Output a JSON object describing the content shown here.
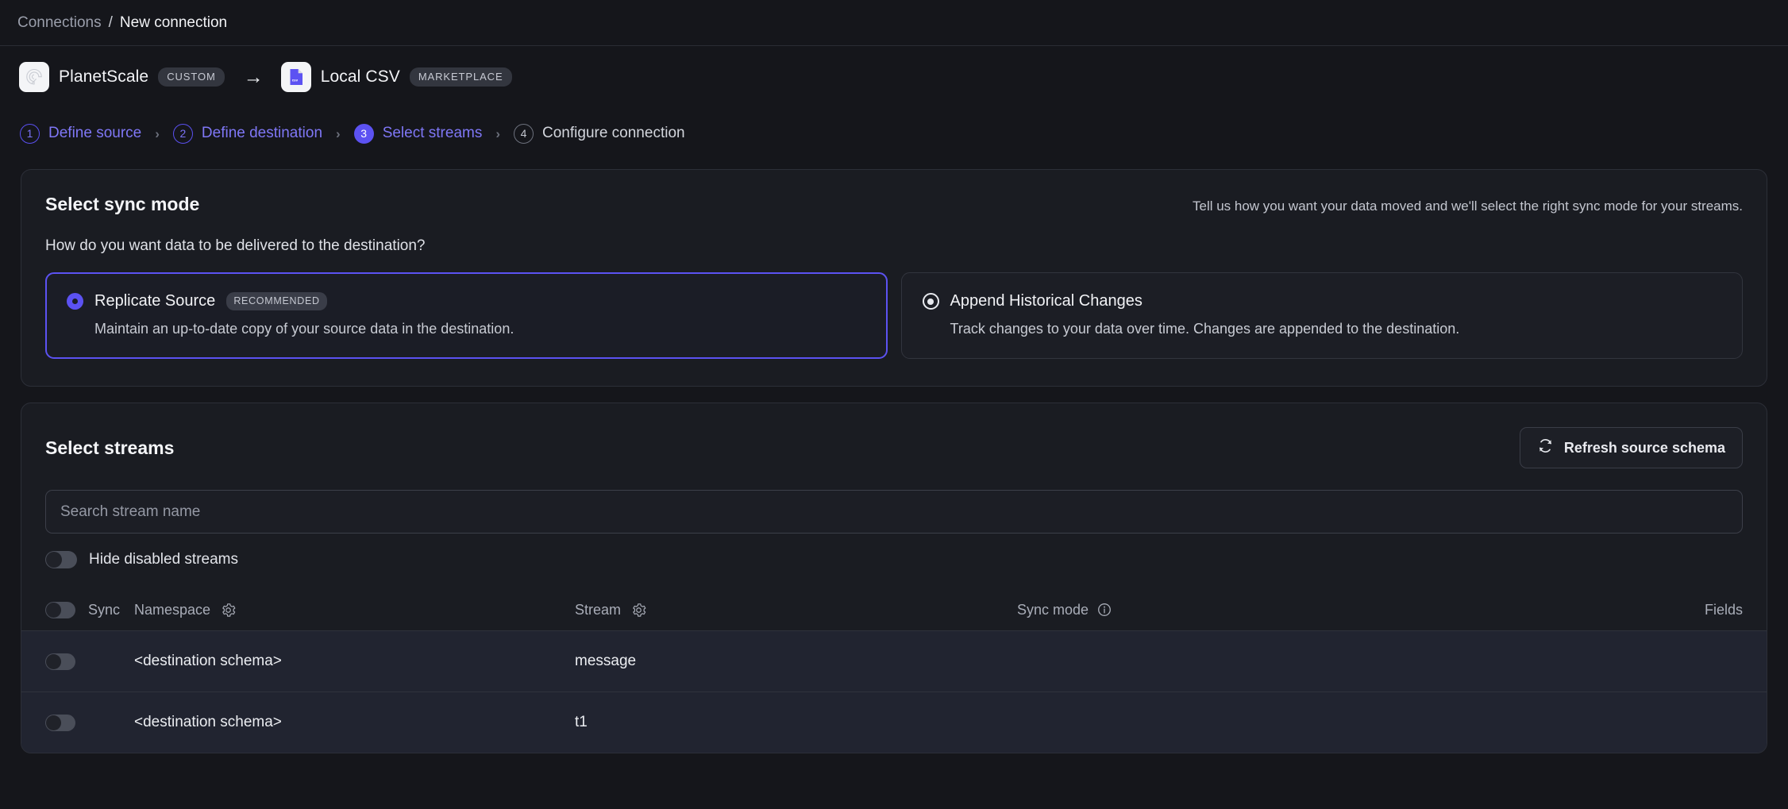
{
  "breadcrumb": {
    "parent": "Connections",
    "separator": "/",
    "current": "New connection"
  },
  "connector": {
    "source": {
      "name": "PlanetScale",
      "badge": "CUSTOM",
      "icon": "planetscale-logo"
    },
    "arrow": "→",
    "destination": {
      "name": "Local CSV",
      "badge": "MARKETPLACE",
      "icon": "csv-file-icon",
      "file_label": "csv"
    }
  },
  "steps": [
    {
      "number": "1",
      "label": "Define source",
      "state": "done"
    },
    {
      "number": "2",
      "label": "Define destination",
      "state": "done"
    },
    {
      "number": "3",
      "label": "Select streams",
      "state": "active"
    },
    {
      "number": "4",
      "label": "Configure connection",
      "state": "todo"
    }
  ],
  "step_chevron": "›",
  "sync_mode": {
    "title": "Select sync mode",
    "hint": "Tell us how you want your data moved and we'll select the right sync mode for your streams.",
    "question": "How do you want data to be delivered to the destination?",
    "options": [
      {
        "title": "Replicate Source",
        "badge": "RECOMMENDED",
        "description": "Maintain an up-to-date copy of your source data in the destination.",
        "selected": true
      },
      {
        "title": "Append Historical Changes",
        "badge": "",
        "description": "Track changes to your data over time. Changes are appended to the destination.",
        "selected": false
      }
    ]
  },
  "streams": {
    "title": "Select streams",
    "refresh_label": "Refresh source schema",
    "search": {
      "placeholder": "Search stream name",
      "value": ""
    },
    "hide_disabled_label": "Hide disabled streams",
    "hide_disabled_on": false,
    "columns": {
      "sync": "Sync",
      "namespace": "Namespace",
      "stream": "Stream",
      "sync_mode": "Sync mode",
      "fields": "Fields"
    },
    "rows": [
      {
        "namespace": "<destination schema>",
        "stream": "message",
        "sync_mode": "",
        "fields": "",
        "enabled": false
      },
      {
        "namespace": "<destination schema>",
        "stream": "t1",
        "sync_mode": "",
        "fields": "",
        "enabled": false
      }
    ]
  },
  "colors": {
    "accent": "#5c52f2",
    "accent_text": "#7f77f6",
    "page_bg": "#15161b",
    "card_bg": "#1a1c22",
    "row_bg": "#212430"
  }
}
